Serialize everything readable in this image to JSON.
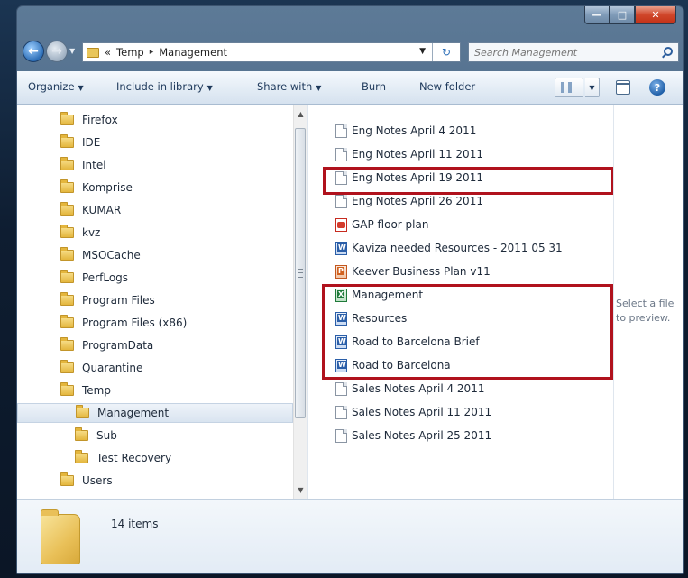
{
  "address": {
    "overflow": "«",
    "crumbs": [
      "Temp",
      "Management"
    ],
    "separator": "▸"
  },
  "search": {
    "placeholder": "Search Management"
  },
  "toolbar": {
    "organize": "Organize",
    "include_in_library": "Include in library",
    "share_with": "Share with",
    "burn": "Burn",
    "new_folder": "New folder"
  },
  "nav_tree": {
    "items": [
      {
        "label": "Firefox"
      },
      {
        "label": "IDE"
      },
      {
        "label": "Intel"
      },
      {
        "label": "Komprise"
      },
      {
        "label": "KUMAR"
      },
      {
        "label": "kvz"
      },
      {
        "label": "MSOCache"
      },
      {
        "label": "PerfLogs"
      },
      {
        "label": "Program Files"
      },
      {
        "label": "Program Files (x86)"
      },
      {
        "label": "ProgramData"
      },
      {
        "label": "Quarantine"
      },
      {
        "label": "Temp"
      },
      {
        "label": "Management",
        "selected": true
      },
      {
        "label": "Sub"
      },
      {
        "label": "Test Recovery"
      },
      {
        "label": "Users"
      }
    ]
  },
  "files": [
    {
      "name": "Eng Notes April 4 2011",
      "icon": "document-icon"
    },
    {
      "name": "Eng Notes April 11 2011",
      "icon": "document-icon"
    },
    {
      "name": "Eng Notes April 19 2011",
      "icon": "document-icon"
    },
    {
      "name": "Eng Notes April 26 2011",
      "icon": "document-icon"
    },
    {
      "name": "GAP floor plan",
      "icon": "pdf-icon"
    },
    {
      "name": "Kaviza needed Resources - 2011 05 31",
      "icon": "word-icon"
    },
    {
      "name": "Keever Business Plan v11",
      "icon": "powerpoint-icon"
    },
    {
      "name": "Management",
      "icon": "excel-icon"
    },
    {
      "name": "Resources",
      "icon": "word-icon"
    },
    {
      "name": "Road to Barcelona Brief",
      "icon": "word-icon"
    },
    {
      "name": "Road to Barcelona",
      "icon": "word-icon"
    },
    {
      "name": "Sales Notes April 4 2011",
      "icon": "document-icon"
    },
    {
      "name": "Sales Notes April 11 2011",
      "icon": "document-icon"
    },
    {
      "name": "Sales Notes April 25 2011",
      "icon": "document-icon"
    }
  ],
  "preview": {
    "message": "Select a file to preview."
  },
  "details": {
    "item_count": "14 items"
  },
  "colors": {
    "highlight": "#b0121d",
    "window_frame": "#4a6886",
    "folder": "#e9c058"
  }
}
